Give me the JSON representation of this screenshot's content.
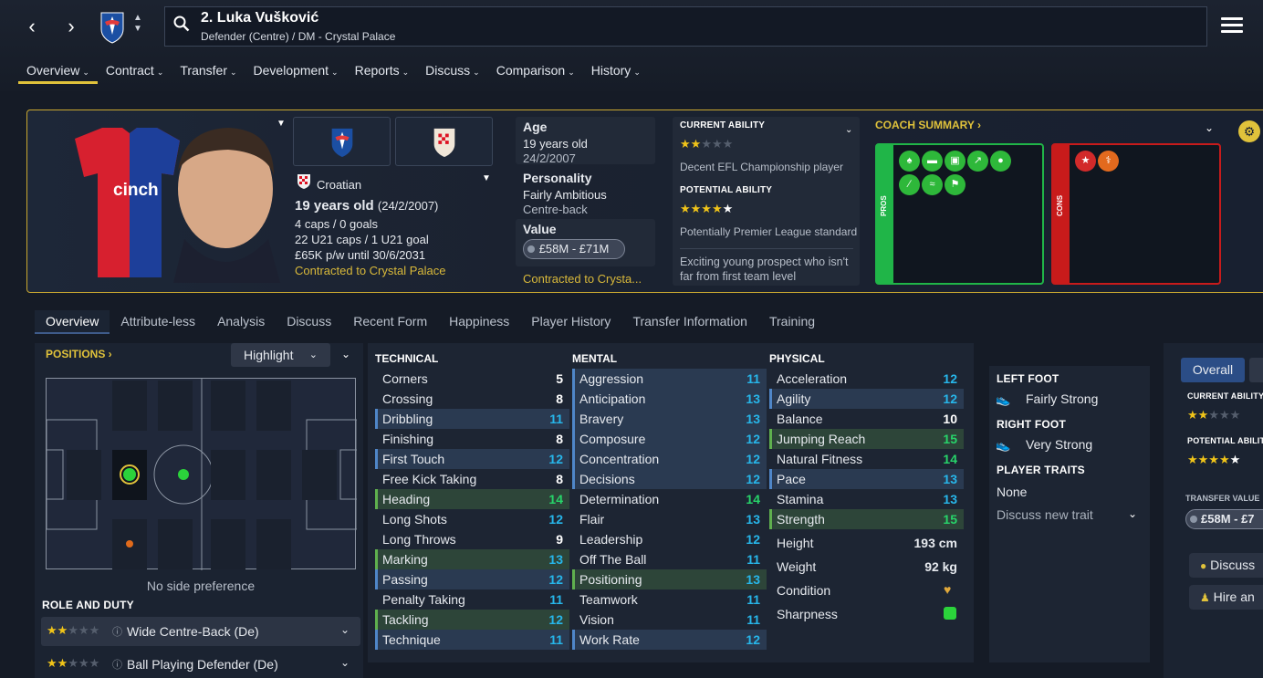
{
  "header": {
    "player_name": "2. Luka Vušković",
    "player_subtitle": "Defender (Centre) / DM - Crystal Palace"
  },
  "main_tabs": [
    {
      "label": "Overview"
    },
    {
      "label": "Contract"
    },
    {
      "label": "Transfer"
    },
    {
      "label": "Development"
    },
    {
      "label": "Reports"
    },
    {
      "label": "Discuss"
    },
    {
      "label": "Comparison"
    },
    {
      "label": "History"
    }
  ],
  "profile": {
    "nationality": "Croatian",
    "age_line": "19 years old",
    "age_dob": "(24/2/2007)",
    "caps": "4 caps / 0 goals",
    "u21": "22 U21 caps / 1 U21 goal",
    "wage": "£65K p/w until 30/6/2031",
    "contract": "Contracted to Crystal Palace",
    "shirt_sponsor": "cinch"
  },
  "details": {
    "age_label": "Age",
    "age_value": "19 years old",
    "dob": "24/2/2007",
    "personality_label": "Personality",
    "personality_value": "Fairly Ambitious",
    "position": "Centre-back",
    "value_label": "Value",
    "value": "£58M - £71M",
    "contract_short": "Contracted to Crysta..."
  },
  "ability": {
    "current_label": "CURRENT ABILITY",
    "current_stars": 2,
    "current_text": "Decent EFL Championship player",
    "potential_label": "POTENTIAL ABILITY",
    "potential_stars": 4,
    "potential_text": "Potentially Premier League standard",
    "summary": "Exciting young prospect who isn't far from first team level"
  },
  "coach": {
    "title": "COACH SUMMARY",
    "pros_label": "PROS",
    "cons_label": "CONS"
  },
  "sub_tabs": [
    {
      "label": "Overview"
    },
    {
      "label": "Attribute-less"
    },
    {
      "label": "Analysis"
    },
    {
      "label": "Discuss"
    },
    {
      "label": "Recent Form"
    },
    {
      "label": "Happiness"
    },
    {
      "label": "Player History"
    },
    {
      "label": "Transfer Information"
    },
    {
      "label": "Training"
    }
  ],
  "positions": {
    "title": "POSITIONS",
    "highlight": "Highlight",
    "side_pref": "No side preference",
    "role_title": "ROLE AND DUTY",
    "roles": [
      {
        "stars": 2,
        "label": "Wide Centre-Back (De)"
      },
      {
        "stars": 2,
        "label": "Ball Playing Defender (De)"
      }
    ]
  },
  "attributes": {
    "technical_title": "TECHNICAL",
    "mental_title": "MENTAL",
    "physical_title": "PHYSICAL",
    "technical": [
      {
        "name": "Corners",
        "value": "5"
      },
      {
        "name": "Crossing",
        "value": "8"
      },
      {
        "name": "Dribbling",
        "value": "11"
      },
      {
        "name": "Finishing",
        "value": "8"
      },
      {
        "name": "First Touch",
        "value": "12"
      },
      {
        "name": "Free Kick Taking",
        "value": "8"
      },
      {
        "name": "Heading",
        "value": "14"
      },
      {
        "name": "Long Shots",
        "value": "12"
      },
      {
        "name": "Long Throws",
        "value": "9"
      },
      {
        "name": "Marking",
        "value": "13"
      },
      {
        "name": "Passing",
        "value": "12"
      },
      {
        "name": "Penalty Taking",
        "value": "11"
      },
      {
        "name": "Tackling",
        "value": "12"
      },
      {
        "name": "Technique",
        "value": "11"
      }
    ],
    "mental": [
      {
        "name": "Aggression",
        "value": "11"
      },
      {
        "name": "Anticipation",
        "value": "13"
      },
      {
        "name": "Bravery",
        "value": "13"
      },
      {
        "name": "Composure",
        "value": "12"
      },
      {
        "name": "Concentration",
        "value": "12"
      },
      {
        "name": "Decisions",
        "value": "12"
      },
      {
        "name": "Determination",
        "value": "14"
      },
      {
        "name": "Flair",
        "value": "13"
      },
      {
        "name": "Leadership",
        "value": "12"
      },
      {
        "name": "Off The Ball",
        "value": "11"
      },
      {
        "name": "Positioning",
        "value": "13"
      },
      {
        "name": "Teamwork",
        "value": "11"
      },
      {
        "name": "Vision",
        "value": "11"
      },
      {
        "name": "Work Rate",
        "value": "12"
      }
    ],
    "physical": [
      {
        "name": "Acceleration",
        "value": "12"
      },
      {
        "name": "Agility",
        "value": "12"
      },
      {
        "name": "Balance",
        "value": "10"
      },
      {
        "name": "Jumping Reach",
        "value": "15"
      },
      {
        "name": "Natural Fitness",
        "value": "14"
      },
      {
        "name": "Pace",
        "value": "13"
      },
      {
        "name": "Stamina",
        "value": "13"
      },
      {
        "name": "Strength",
        "value": "15"
      }
    ],
    "height_label": "Height",
    "height": "193 cm",
    "weight_label": "Weight",
    "weight": "92 kg",
    "condition_label": "Condition",
    "sharpness_label": "Sharpness"
  },
  "feet": {
    "left_title": "LEFT FOOT",
    "left_value": "Fairly Strong",
    "right_title": "RIGHT FOOT",
    "right_value": "Very Strong",
    "traits_title": "PLAYER TRAITS",
    "traits_value": "None",
    "discuss_trait": "Discuss new trait"
  },
  "far_panel": {
    "toggle": "Overall",
    "current_label": "CURRENT ABILITY",
    "potential_label": "POTENTIAL ABILITY",
    "transfer_label": "TRANSFER VALUE",
    "transfer_value": "£58M - £7",
    "discuss_btn": "Discuss",
    "hire_btn": "Hire an"
  },
  "colors": {
    "accent_gold": "#e0c23b",
    "pros_green": "#20b548",
    "cons_red": "#c81b1b",
    "attr_cyan": "#27b6ea",
    "attr_green": "#27d46a"
  }
}
